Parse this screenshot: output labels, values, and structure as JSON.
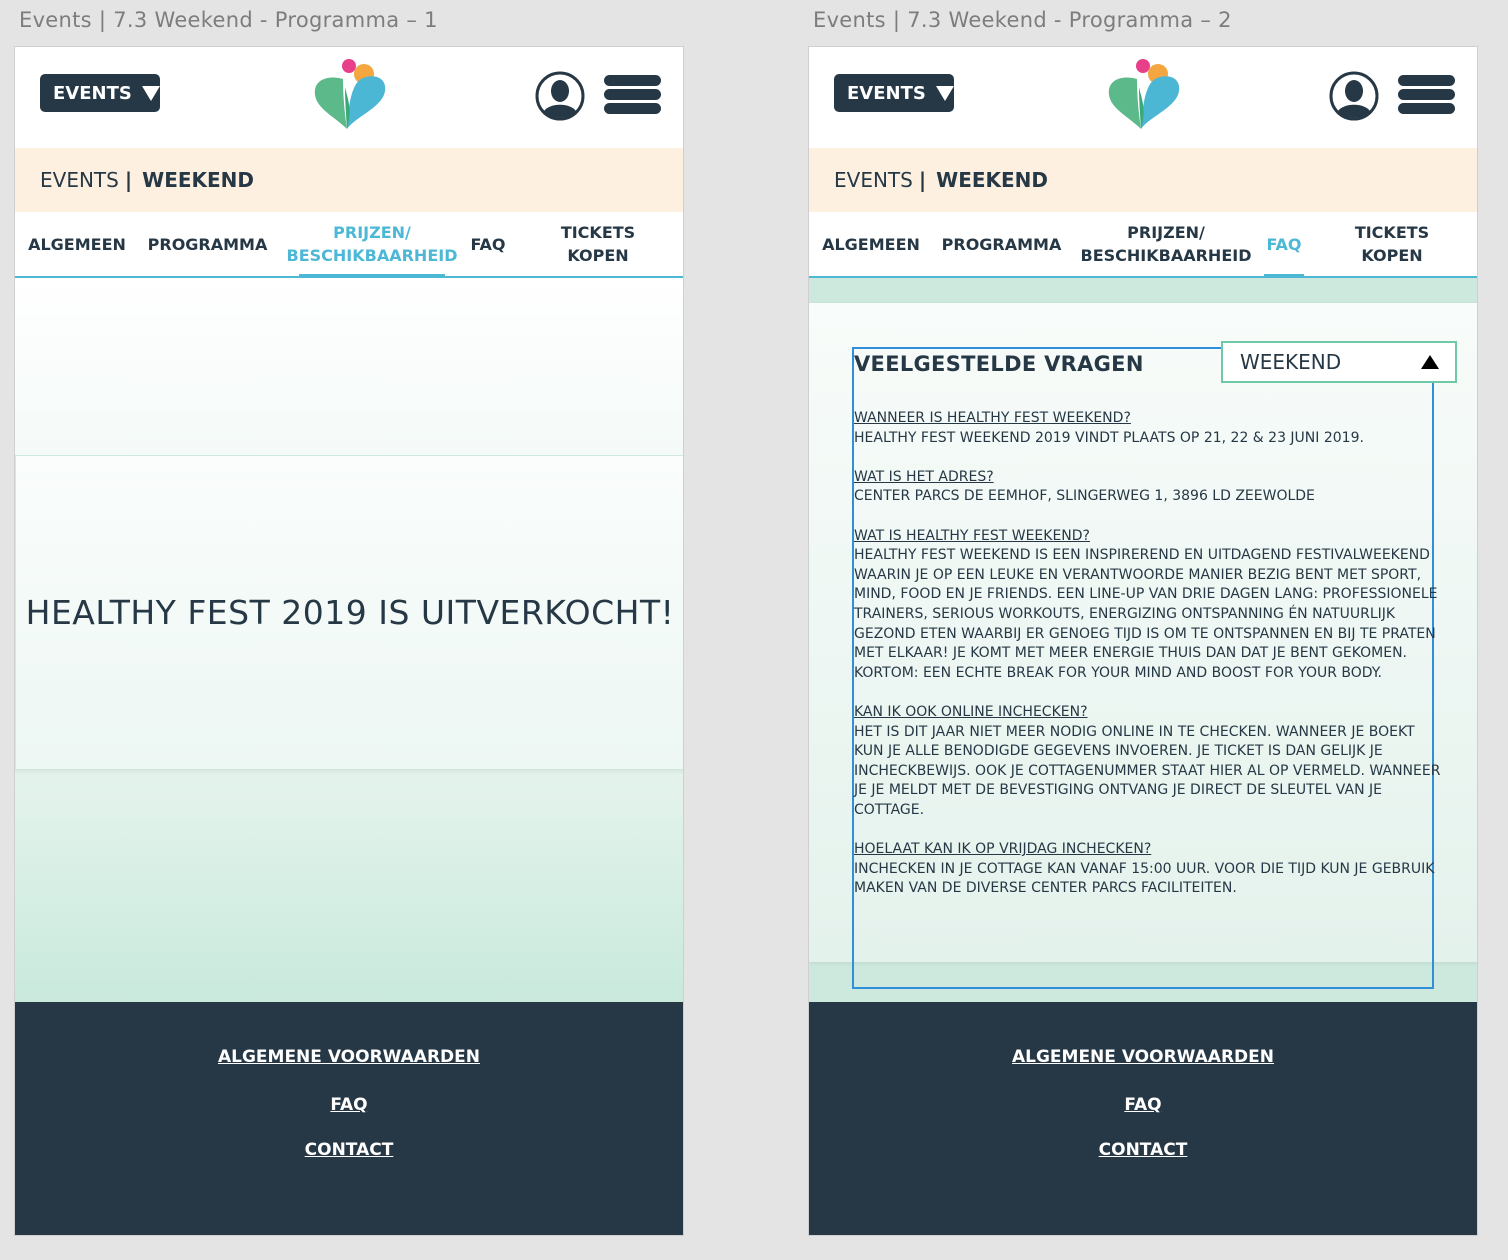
{
  "artboards": [
    {
      "title": "Events | 7.3 Weekend - Programma – 1",
      "header": {
        "events_label": "EVENTS"
      },
      "breadcrumb": {
        "section": "EVENTS",
        "separator": "|",
        "current": "WEEKEND"
      },
      "tabs": [
        {
          "label": "ALGEMEEN",
          "active": false
        },
        {
          "label": "PROGRAMMA",
          "active": false
        },
        {
          "label_line1": "PRIJZEN/",
          "label_line2": "BESCHIKBAARHEID",
          "active": true
        },
        {
          "label": "FAQ",
          "active": false
        },
        {
          "label": "TICKETS KOPEN",
          "active": false
        }
      ],
      "main": {
        "soldout_message": "HEALTHY FEST 2019 IS UITVERKOCHT!"
      }
    },
    {
      "title": "Events | 7.3 Weekend - Programma – 2",
      "header": {
        "events_label": "EVENTS"
      },
      "breadcrumb": {
        "section": "EVENTS",
        "separator": "|",
        "current": "WEEKEND"
      },
      "tabs": [
        {
          "label": "ALGEMEEN",
          "active": false
        },
        {
          "label": "PROGRAMMA",
          "active": false
        },
        {
          "label_line1": "PRIJZEN/",
          "label_line2": "BESCHIKBAARHEID",
          "active": false
        },
        {
          "label": "FAQ",
          "active": true
        },
        {
          "label": "TICKETS KOPEN",
          "active": false
        }
      ],
      "faq": {
        "title": "VEELGESTELDE VRAGEN",
        "select_value": "WEEKEND",
        "items": [
          {
            "q": "WANNEER IS HEALTHY FEST WEEKEND?",
            "a": "HEALTHY FEST WEEKEND 2019 VINDT PLAATS OP 21, 22 & 23 JUNI 2019."
          },
          {
            "q": "WAT IS HET ADRES?",
            "a": "CENTER PARCS DE EEMHOF, SLINGERWEG 1, 3896 LD ZEEWOLDE"
          },
          {
            "q": "WAT IS HEALTHY FEST WEEKEND?",
            "a": "HEALTHY FEST WEEKEND IS EEN INSPIREREND EN UITDAGEND FESTIVALWEEKEND WAARIN JE OP EEN LEUKE EN VERANTWOORDE MANIER BEZIG BENT MET SPORT, MIND, FOOD EN JE FRIENDS. EEN LINE-UP VAN DRIE DAGEN LANG: PROFESSIONELE TRAINERS, SERIOUS WORKOUTS, ENERGIZING ONTSPANNING ÉN NATUURLIJK GEZOND ETEN WAARBIJ ER GENOEG TIJD IS OM TE ONTSPANNEN EN BIJ TE PRATEN MET ELKAAR! JE KOMT MET MEER ENERGIE THUIS DAN DAT JE BENT GEKOMEN. KORTOM: EEN ECHTE BREAK FOR YOUR MIND AND BOOST FOR YOUR BODY."
          },
          {
            "q": "KAN IK OOK ONLINE INCHECKEN?",
            "a": "HET IS DIT JAAR NIET MEER NODIG ONLINE IN TE CHECKEN. WANNEER JE BOEKT KUN JE ALLE BENODIGDE GEGEVENS INVOEREN. JE TICKET IS DAN GELIJK JE INCHECKBEWIJS. OOK JE COTTAGENUMMER STAAT HIER AL OP VERMELD. WANNEER JE JE MELDT MET DE BEVESTIGING ONTVANG JE DIRECT DE SLEUTEL VAN JE COTTAGE."
          },
          {
            "q": "HOELAAT KAN IK OP VRIJDAG INCHECKEN?",
            "a": "INCHECKEN IN JE COTTAGE KAN VANAF 15:00 UUR. VOOR DIE TIJD KUN JE GEBRUIK MAKEN VAN DE DIVERSE CENTER PARCS FACILITEITEN."
          }
        ]
      }
    }
  ],
  "footer": {
    "links": [
      "ALGEMENE VOORWAARDEN",
      "FAQ",
      "CONTACT"
    ]
  },
  "colors": {
    "navy": "#263845",
    "accent_blue": "#4db8d6",
    "cream": "#fdf0e1",
    "mint": "#cde9de",
    "select_border": "#6ccaa6"
  },
  "icons": [
    "caret-down-icon",
    "heart-logo",
    "user-avatar-icon",
    "hamburger-menu-icon",
    "triangle-up-icon"
  ]
}
